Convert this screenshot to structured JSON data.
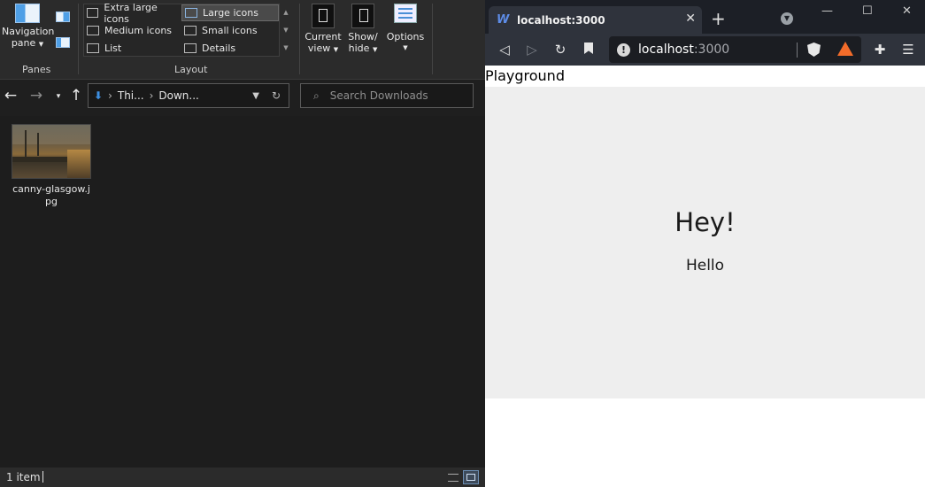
{
  "explorer": {
    "ribbon": {
      "panes_group_label": "Panes",
      "layout_group_label": "Layout",
      "navigation_pane_label": "Navigation",
      "navigation_pane_label2": "pane",
      "layout_options": [
        "Extra large icons",
        "Large icons",
        "Medium icons",
        "Small icons",
        "List",
        "Details"
      ],
      "selected_layout": "Large icons",
      "current_view_label": "Current",
      "current_view_label2": "view",
      "show_hide_label": "Show/",
      "show_hide_label2": "hide",
      "options_label": "Options"
    },
    "address": {
      "crumbs": [
        "Thi...",
        "Down..."
      ],
      "search_placeholder": "Search Downloads"
    },
    "files": [
      {
        "name": "canny-glasgow.jpg"
      }
    ],
    "status": {
      "count": "1 item"
    }
  },
  "browser": {
    "tab_title": "localhost:3000",
    "url_host": "localhost",
    "url_port": ":3000",
    "page": {
      "heading": "Playground",
      "title": "Hey!",
      "subtitle": "Hello"
    }
  },
  "colors": {
    "accent_blue": "#5e8de8",
    "brave_orange": "#f36c2a",
    "card_bg": "#eeeeee"
  }
}
